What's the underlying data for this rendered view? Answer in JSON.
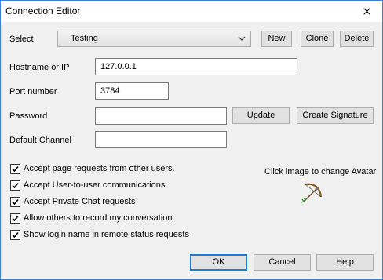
{
  "window": {
    "title": "Connection Editor"
  },
  "select": {
    "label": "Select",
    "value": "Testing"
  },
  "buttons": {
    "new": "New",
    "clone": "Clone",
    "delete": "Delete",
    "update": "Update",
    "create_signature": "Create Signature",
    "ok": "OK",
    "cancel": "Cancel",
    "help": "Help"
  },
  "fields": {
    "hostname_label": "Hostname or IP",
    "hostname_value": "127.0.0.1",
    "port_label": "Port number",
    "port_value": "3784",
    "password_label": "Password",
    "password_value": "",
    "channel_label": "Default Channel",
    "channel_value": ""
  },
  "checkboxes": [
    {
      "label": "Accept page requests from other users.",
      "checked": true
    },
    {
      "label": "Accept User-to-user communications.",
      "checked": true
    },
    {
      "label": "Accept Private Chat requests",
      "checked": true
    },
    {
      "label": "Allow others to record my conversation.",
      "checked": true
    },
    {
      "label": "Show login name in remote status requests",
      "checked": true
    }
  ],
  "avatar": {
    "hint": "Click image to change Avatar",
    "icon": "bow-and-arrow-icon"
  },
  "colors": {
    "accent": "#1e7cd6",
    "border": "#3c7fd6"
  }
}
